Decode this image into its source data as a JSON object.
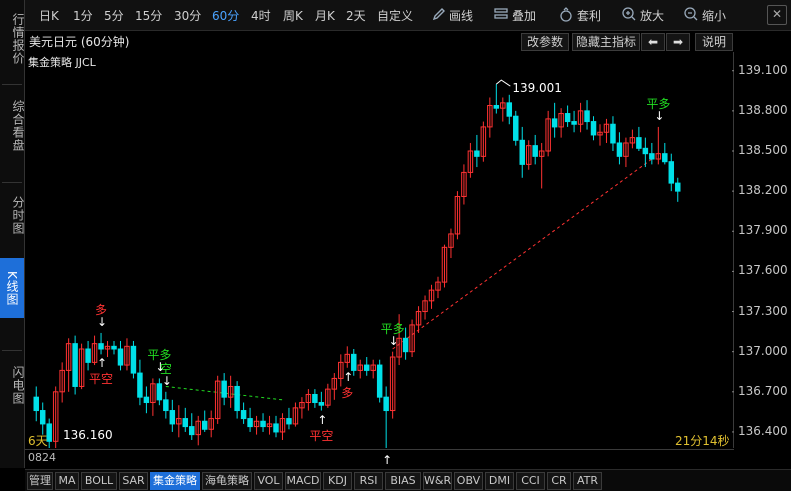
{
  "left_tabs": [
    {
      "label": "行情报价",
      "active": false
    },
    {
      "label": "综合看盘",
      "active": false
    },
    {
      "label": "分时图",
      "active": false
    },
    {
      "label": "K线图",
      "active": true
    },
    {
      "label": "闪电图",
      "active": false
    }
  ],
  "toolbar": {
    "periods": [
      "日K",
      "1分",
      "5分",
      "15分",
      "30分",
      "60分",
      "4时",
      "周K",
      "月K",
      "2天",
      "自定义"
    ],
    "active_period": "60分",
    "draw_label": "画线",
    "overlay_label": "叠加",
    "arbitrage_label": "套利",
    "zoom_in_label": "放大",
    "zoom_out_label": "缩小"
  },
  "header": {
    "symbol_title": "美元日元 (60分钟)",
    "indicator_title": "集金策略 JJCL",
    "param_button": "改参数",
    "hide_button": "隐藏主指标",
    "prev_arrow": "⬅",
    "next_arrow": "➡",
    "help_button": "说明"
  },
  "chart_data": {
    "type": "candlestick",
    "y_ticks": [
      "139.100",
      "138.800",
      "138.500",
      "138.200",
      "137.900",
      "137.600",
      "137.300",
      "137.000",
      "136.700",
      "136.400"
    ],
    "y_range": [
      136.28,
      139.24
    ],
    "high_label": "139.001",
    "low_label": "136.160",
    "colors": {
      "up": "#ff3232",
      "down": "#00e0e8",
      "signal_red": "#ff3232",
      "signal_green": "#22dd22",
      "arrow": "#ffffff"
    },
    "candles": [
      {
        "o": 136.66,
        "h": 136.74,
        "l": 136.48,
        "c": 136.56
      },
      {
        "o": 136.56,
        "h": 136.62,
        "l": 136.38,
        "c": 136.46
      },
      {
        "o": 136.46,
        "h": 136.5,
        "l": 136.16,
        "c": 136.33
      },
      {
        "o": 136.33,
        "h": 136.74,
        "l": 136.28,
        "c": 136.7
      },
      {
        "o": 136.7,
        "h": 136.92,
        "l": 136.62,
        "c": 136.86
      },
      {
        "o": 136.86,
        "h": 137.1,
        "l": 136.7,
        "c": 137.06
      },
      {
        "o": 137.06,
        "h": 137.12,
        "l": 136.68,
        "c": 136.74
      },
      {
        "o": 136.74,
        "h": 137.06,
        "l": 136.72,
        "c": 137.02
      },
      {
        "o": 137.02,
        "h": 137.08,
        "l": 136.86,
        "c": 136.92
      },
      {
        "o": 136.92,
        "h": 137.12,
        "l": 136.9,
        "c": 137.06
      },
      {
        "o": 137.06,
        "h": 137.14,
        "l": 136.98,
        "c": 137.02
      },
      {
        "o": 137.02,
        "h": 137.08,
        "l": 136.96,
        "c": 137.04
      },
      {
        "o": 137.04,
        "h": 137.08,
        "l": 136.98,
        "c": 137.02
      },
      {
        "o": 137.02,
        "h": 137.08,
        "l": 136.86,
        "c": 136.9
      },
      {
        "o": 136.9,
        "h": 137.1,
        "l": 136.86,
        "c": 137.04
      },
      {
        "o": 137.04,
        "h": 137.08,
        "l": 136.8,
        "c": 136.84
      },
      {
        "o": 136.84,
        "h": 136.94,
        "l": 136.6,
        "c": 136.66
      },
      {
        "o": 136.66,
        "h": 136.74,
        "l": 136.54,
        "c": 136.62
      },
      {
        "o": 136.62,
        "h": 136.8,
        "l": 136.52,
        "c": 136.76
      },
      {
        "o": 136.76,
        "h": 136.8,
        "l": 136.6,
        "c": 136.64
      },
      {
        "o": 136.64,
        "h": 136.7,
        "l": 136.5,
        "c": 136.56
      },
      {
        "o": 136.56,
        "h": 136.64,
        "l": 136.4,
        "c": 136.46
      },
      {
        "o": 136.46,
        "h": 136.6,
        "l": 136.36,
        "c": 136.5
      },
      {
        "o": 136.5,
        "h": 136.58,
        "l": 136.4,
        "c": 136.44
      },
      {
        "o": 136.44,
        "h": 136.54,
        "l": 136.34,
        "c": 136.38
      },
      {
        "o": 136.38,
        "h": 136.52,
        "l": 136.3,
        "c": 136.48
      },
      {
        "o": 136.48,
        "h": 136.56,
        "l": 136.4,
        "c": 136.42
      },
      {
        "o": 136.42,
        "h": 136.56,
        "l": 136.36,
        "c": 136.5
      },
      {
        "o": 136.5,
        "h": 136.82,
        "l": 136.46,
        "c": 136.78
      },
      {
        "o": 136.78,
        "h": 136.84,
        "l": 136.6,
        "c": 136.66
      },
      {
        "o": 136.66,
        "h": 136.82,
        "l": 136.58,
        "c": 136.74
      },
      {
        "o": 136.74,
        "h": 136.78,
        "l": 136.5,
        "c": 136.56
      },
      {
        "o": 136.56,
        "h": 136.62,
        "l": 136.46,
        "c": 136.5
      },
      {
        "o": 136.5,
        "h": 136.58,
        "l": 136.4,
        "c": 136.44
      },
      {
        "o": 136.44,
        "h": 136.52,
        "l": 136.38,
        "c": 136.48
      },
      {
        "o": 136.48,
        "h": 136.54,
        "l": 136.4,
        "c": 136.44
      },
      {
        "o": 136.44,
        "h": 136.52,
        "l": 136.38,
        "c": 136.46
      },
      {
        "o": 136.46,
        "h": 136.52,
        "l": 136.36,
        "c": 136.4
      },
      {
        "o": 136.4,
        "h": 136.54,
        "l": 136.34,
        "c": 136.5
      },
      {
        "o": 136.5,
        "h": 136.58,
        "l": 136.42,
        "c": 136.46
      },
      {
        "o": 136.46,
        "h": 136.62,
        "l": 136.44,
        "c": 136.58
      },
      {
        "o": 136.58,
        "h": 136.66,
        "l": 136.5,
        "c": 136.62
      },
      {
        "o": 136.62,
        "h": 136.72,
        "l": 136.56,
        "c": 136.68
      },
      {
        "o": 136.68,
        "h": 136.72,
        "l": 136.58,
        "c": 136.62
      },
      {
        "o": 136.62,
        "h": 136.7,
        "l": 136.56,
        "c": 136.6
      },
      {
        "o": 136.6,
        "h": 136.76,
        "l": 136.58,
        "c": 136.72
      },
      {
        "o": 136.72,
        "h": 136.84,
        "l": 136.64,
        "c": 136.8
      },
      {
        "o": 136.8,
        "h": 136.98,
        "l": 136.74,
        "c": 136.92
      },
      {
        "o": 136.92,
        "h": 137.04,
        "l": 136.88,
        "c": 136.98
      },
      {
        "o": 136.98,
        "h": 137.02,
        "l": 136.82,
        "c": 136.86
      },
      {
        "o": 136.86,
        "h": 136.94,
        "l": 136.8,
        "c": 136.9
      },
      {
        "o": 136.9,
        "h": 136.96,
        "l": 136.82,
        "c": 136.86
      },
      {
        "o": 136.86,
        "h": 136.94,
        "l": 136.8,
        "c": 136.9
      },
      {
        "o": 136.9,
        "h": 136.94,
        "l": 136.62,
        "c": 136.66
      },
      {
        "o": 136.66,
        "h": 136.74,
        "l": 136.26,
        "c": 136.56
      },
      {
        "o": 136.56,
        "h": 137.0,
        "l": 136.5,
        "c": 136.96
      },
      {
        "o": 136.96,
        "h": 137.28,
        "l": 136.9,
        "c": 137.1
      },
      {
        "o": 137.1,
        "h": 137.18,
        "l": 136.94,
        "c": 137.0
      },
      {
        "o": 137.0,
        "h": 137.24,
        "l": 136.96,
        "c": 137.2
      },
      {
        "o": 137.2,
        "h": 137.34,
        "l": 137.14,
        "c": 137.3
      },
      {
        "o": 137.3,
        "h": 137.42,
        "l": 137.24,
        "c": 137.38
      },
      {
        "o": 137.38,
        "h": 137.5,
        "l": 137.32,
        "c": 137.46
      },
      {
        "o": 137.46,
        "h": 137.56,
        "l": 137.4,
        "c": 137.52
      },
      {
        "o": 137.52,
        "h": 137.8,
        "l": 137.48,
        "c": 137.78
      },
      {
        "o": 137.78,
        "h": 137.92,
        "l": 137.7,
        "c": 137.88
      },
      {
        "o": 137.88,
        "h": 138.2,
        "l": 137.84,
        "c": 138.16
      },
      {
        "o": 138.16,
        "h": 138.4,
        "l": 138.1,
        "c": 138.34
      },
      {
        "o": 138.34,
        "h": 138.56,
        "l": 138.3,
        "c": 138.5
      },
      {
        "o": 138.5,
        "h": 138.62,
        "l": 138.38,
        "c": 138.46
      },
      {
        "o": 138.46,
        "h": 138.72,
        "l": 138.42,
        "c": 138.68
      },
      {
        "o": 138.68,
        "h": 138.9,
        "l": 138.6,
        "c": 138.84
      },
      {
        "o": 138.84,
        "h": 139.0,
        "l": 138.78,
        "c": 138.82
      },
      {
        "o": 138.82,
        "h": 138.9,
        "l": 138.72,
        "c": 138.86
      },
      {
        "o": 138.86,
        "h": 138.92,
        "l": 138.7,
        "c": 138.76
      },
      {
        "o": 138.76,
        "h": 138.8,
        "l": 138.54,
        "c": 138.58
      },
      {
        "o": 138.58,
        "h": 138.68,
        "l": 138.3,
        "c": 138.4
      },
      {
        "o": 138.4,
        "h": 138.58,
        "l": 138.36,
        "c": 138.54
      },
      {
        "o": 138.54,
        "h": 138.62,
        "l": 138.4,
        "c": 138.46
      },
      {
        "o": 138.46,
        "h": 138.56,
        "l": 138.22,
        "c": 138.5
      },
      {
        "o": 138.5,
        "h": 138.8,
        "l": 138.46,
        "c": 138.74
      },
      {
        "o": 138.74,
        "h": 138.86,
        "l": 138.6,
        "c": 138.68
      },
      {
        "o": 138.68,
        "h": 138.82,
        "l": 138.6,
        "c": 138.78
      },
      {
        "o": 138.78,
        "h": 138.84,
        "l": 138.68,
        "c": 138.72
      },
      {
        "o": 138.72,
        "h": 138.8,
        "l": 138.64,
        "c": 138.7
      },
      {
        "o": 138.7,
        "h": 138.86,
        "l": 138.64,
        "c": 138.8
      },
      {
        "o": 138.8,
        "h": 138.88,
        "l": 138.66,
        "c": 138.72
      },
      {
        "o": 138.72,
        "h": 138.76,
        "l": 138.58,
        "c": 138.62
      },
      {
        "o": 138.62,
        "h": 138.7,
        "l": 138.54,
        "c": 138.64
      },
      {
        "o": 138.64,
        "h": 138.74,
        "l": 138.56,
        "c": 138.7
      },
      {
        "o": 138.7,
        "h": 138.76,
        "l": 138.5,
        "c": 138.56
      },
      {
        "o": 138.56,
        "h": 138.64,
        "l": 138.4,
        "c": 138.46
      },
      {
        "o": 138.46,
        "h": 138.6,
        "l": 138.38,
        "c": 138.56
      },
      {
        "o": 138.56,
        "h": 138.66,
        "l": 138.52,
        "c": 138.6
      },
      {
        "o": 138.6,
        "h": 138.68,
        "l": 138.5,
        "c": 138.52
      },
      {
        "o": 138.52,
        "h": 138.6,
        "l": 138.38,
        "c": 138.48
      },
      {
        "o": 138.48,
        "h": 138.56,
        "l": 138.4,
        "c": 138.44
      },
      {
        "o": 138.44,
        "h": 138.68,
        "l": 138.4,
        "c": 138.48
      },
      {
        "o": 138.48,
        "h": 138.56,
        "l": 138.4,
        "c": 138.42
      },
      {
        "o": 138.42,
        "h": 138.48,
        "l": 138.2,
        "c": 138.26
      },
      {
        "o": 138.26,
        "h": 138.3,
        "l": 138.12,
        "c": 138.2
      }
    ],
    "trend_line": {
      "from_index": 55,
      "to_index": 95,
      "from_price": 137.02,
      "to_price": 138.44
    },
    "green_line": {
      "from_index": 20,
      "to_index": 38,
      "from_price": 136.74,
      "to_price": 136.64
    },
    "signals": [
      {
        "index": 10,
        "text": "多",
        "color": "red",
        "side": "above"
      },
      {
        "index": 10,
        "text": "平空",
        "color": "red",
        "side": "below"
      },
      {
        "index": 19,
        "text": "平多",
        "color": "green",
        "side": "above"
      },
      {
        "index": 20,
        "text": "空",
        "color": "green",
        "side": "above"
      },
      {
        "index": 48,
        "text": "多",
        "color": "red",
        "side": "below"
      },
      {
        "index": 44,
        "text": "平空",
        "color": "red",
        "side": "below"
      },
      {
        "index": 55,
        "text": "平多",
        "color": "green",
        "side": "above"
      },
      {
        "index": 54,
        "text": "多",
        "color": "red",
        "side": "below"
      },
      {
        "index": 96,
        "text": "平多",
        "color": "green",
        "side": "above"
      }
    ]
  },
  "status": {
    "left_text": "6天",
    "low_value": "136.160",
    "timer": "21分14秒",
    "code": "0824"
  },
  "bottom_tabs": [
    "管理",
    "MA",
    "BOLL",
    "SAR",
    "集金策略",
    "海龟策略",
    "VOL",
    "MACD",
    "KDJ",
    "RSI",
    "BIAS",
    "W&R",
    "OBV",
    "DMI",
    "CCI",
    "CR",
    "ATR"
  ],
  "active_bottom_tab": "集金策略"
}
